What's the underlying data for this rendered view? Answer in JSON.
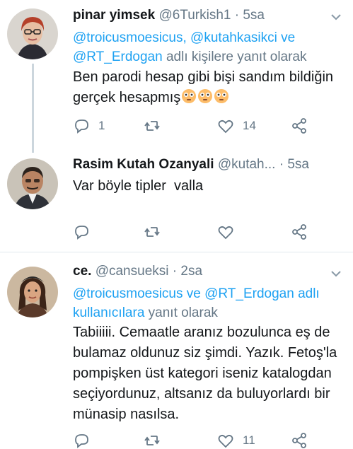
{
  "tweets": [
    {
      "name": "pinar yimsek",
      "handle": "@6Turkish1",
      "dot": "·",
      "time": "5sa",
      "reply_mentions": "@troicusmoesicus, @kutahkasikci ve @RT_Erdogan",
      "reply_suffix": " adlı kişilere yanıt olarak",
      "text": "Ben parodi hesap gibi bişi sandım bildiğin gerçek hesapmış",
      "emoji_count": 3,
      "reply_count": "1",
      "like_count": "14"
    },
    {
      "name": "Rasim Kutah Ozanyali",
      "handle": "@kutah...",
      "dot": "·",
      "time": "5sa",
      "text": "Var böyle tipler  valla"
    },
    {
      "name": "ce.",
      "handle": "@cansueksi",
      "dot": "·",
      "time": "2sa",
      "reply_mentions": "@troicusmoesicus ve @RT_Erdogan adlı kullanıcılara",
      "reply_suffix": " yanıt olarak",
      "text": "Tabiiiii. Cemaatle aranız bozulunca eş de bulamaz oldunuz siz şimdi. Yazık. Fetoş'la pompişken üst kategori iseniz katalogdan seçiyordunuz, altsanız da buluyorlardı bir münasip nasılsa.",
      "like_count": "11"
    }
  ],
  "colors": {
    "accent": "#1da1f2",
    "muted": "#657786",
    "text": "#14171a",
    "divider": "#e1e8ed",
    "thread_line": "#ccd6dd"
  },
  "icons": [
    "reply-icon",
    "retweet-icon",
    "like-icon",
    "share-icon",
    "chevron-down-icon",
    "flushed-face-emoji"
  ]
}
